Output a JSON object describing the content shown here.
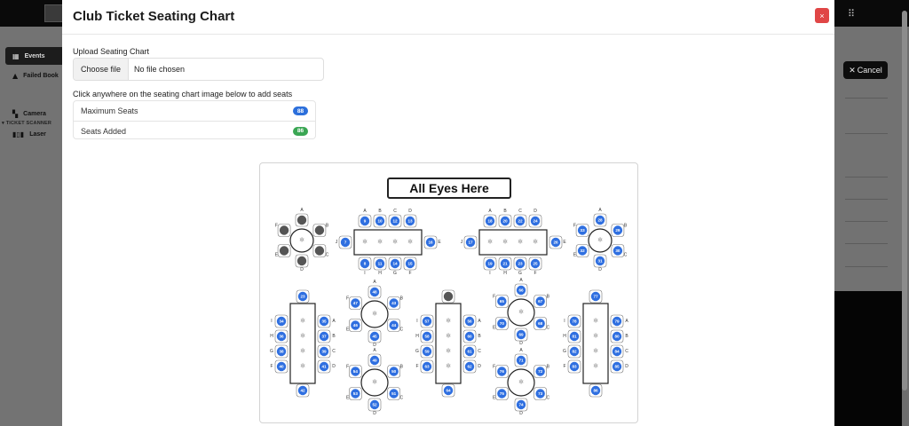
{
  "background": {
    "sidebar": {
      "items": [
        {
          "label": "Events",
          "icon": "grid-icon",
          "active": true
        },
        {
          "label": "Failed Book",
          "icon": "warning-icon",
          "active": false
        },
        {
          "label": "Camera",
          "icon": "qr-icon",
          "active": false
        },
        {
          "label": "Laser",
          "icon": "barcode-icon",
          "active": false
        }
      ],
      "section_label": "TICKET SCANNER"
    },
    "cancel_label": "Cancel"
  },
  "modal": {
    "title": "Club Ticket Seating Chart",
    "close_label": "×",
    "upload_label": "Upload Seating Chart",
    "file_button": "Choose file",
    "file_status": "No file chosen",
    "hint": "Click anywhere on the seating chart image below to add seats",
    "stats": [
      {
        "label": "Maximum Seats",
        "value": "88",
        "color": "#2c6fdb"
      },
      {
        "label": "Seats Added",
        "value": "86",
        "color": "#3aa653"
      }
    ]
  },
  "seating_chart": {
    "title": "All Eyes Here",
    "colors": {
      "added": "#2f6fe0",
      "unassigned": "#555555"
    },
    "tables": [
      {
        "shape": "round",
        "size": "small",
        "top_letter": "A",
        "seats": [
          "",
          "",
          "",
          "",
          "",
          ""
        ],
        "side_letters": [
          "B",
          "C",
          "D",
          "E",
          "F"
        ]
      },
      {
        "shape": "rect",
        "top_letters": [
          "A",
          "B",
          "C",
          "D"
        ],
        "bottom_letters": [
          "I",
          "H",
          "G",
          "F"
        ],
        "left_letter": "J",
        "right_letter": "E",
        "top_seats": [
          "9",
          "10",
          "12",
          "13"
        ],
        "bottom_seats": [
          "8",
          "11",
          "14",
          "15"
        ],
        "left_seat": "7",
        "right_seat": "16"
      },
      {
        "shape": "rect",
        "top_letters": [
          "A",
          "B",
          "C",
          "D"
        ],
        "bottom_letters": [
          "I",
          "H",
          "G",
          "F"
        ],
        "left_letter": "J",
        "right_letter": "E",
        "top_seats": [
          "18",
          "20",
          "22",
          "24"
        ],
        "bottom_seats": [
          "19",
          "21",
          "23",
          "25"
        ],
        "left_seat": "17",
        "right_seat": "26"
      },
      {
        "shape": "round",
        "size": "small",
        "top_letter": "A",
        "seats": [
          "28",
          "29",
          "30",
          "31",
          "32",
          "33"
        ],
        "side_letters": [
          "B",
          "C",
          "D",
          "E",
          "F"
        ]
      },
      {
        "shape": "tall",
        "letters_left": [
          "I",
          "H",
          "G",
          "F"
        ],
        "letters_right": [
          "A",
          "B",
          "C",
          "D"
        ],
        "top_seat": "23",
        "bottom_seat": "42",
        "left_seats": [
          "34",
          "36",
          "38",
          "40"
        ],
        "right_seats": [
          "35",
          "37",
          "39",
          "41"
        ]
      },
      {
        "shape": "round",
        "size": "large",
        "top_letter": "A",
        "seats": [
          "48",
          "43",
          "44",
          "45",
          "46",
          "47"
        ],
        "side_letters": [
          "B",
          "C",
          "D",
          "E",
          "F"
        ]
      },
      {
        "shape": "tall",
        "letters_left": [
          "I",
          "H",
          "G",
          "F"
        ],
        "letters_right": [
          "A",
          "B",
          "C",
          "D"
        ],
        "top_seat": "",
        "bottom_seat": "64",
        "left_seats": [
          "57",
          "58",
          "59",
          "63"
        ],
        "right_seats": [
          "56",
          "60",
          "61",
          "62"
        ]
      },
      {
        "shape": "round",
        "size": "large",
        "top_letter": "A",
        "seats": [
          "66",
          "67",
          "68",
          "69",
          "70",
          "65"
        ],
        "side_letters": [
          "B",
          "C",
          "D",
          "E",
          "F"
        ]
      },
      {
        "shape": "tall",
        "letters_left": [
          "I",
          "H",
          "G",
          "F"
        ],
        "letters_right": [
          "A",
          "B",
          "C",
          "D"
        ],
        "top_seat": "77",
        "bottom_seat": "86",
        "left_seats": [
          "78",
          "81",
          "82",
          "83"
        ],
        "right_seats": [
          "79",
          "80",
          "84",
          "85"
        ]
      },
      {
        "shape": "round",
        "size": "large",
        "top_letter": "A",
        "seats": [
          "49",
          "50",
          "51",
          "52",
          "53",
          "54"
        ],
        "side_letters": [
          "B",
          "C",
          "D",
          "E",
          "F"
        ]
      },
      {
        "shape": "round",
        "size": "large",
        "top_letter": "A",
        "seats": [
          "71",
          "72",
          "73",
          "74",
          "75",
          "76"
        ],
        "side_letters": [
          "B",
          "C",
          "D",
          "E",
          "F"
        ]
      }
    ]
  }
}
